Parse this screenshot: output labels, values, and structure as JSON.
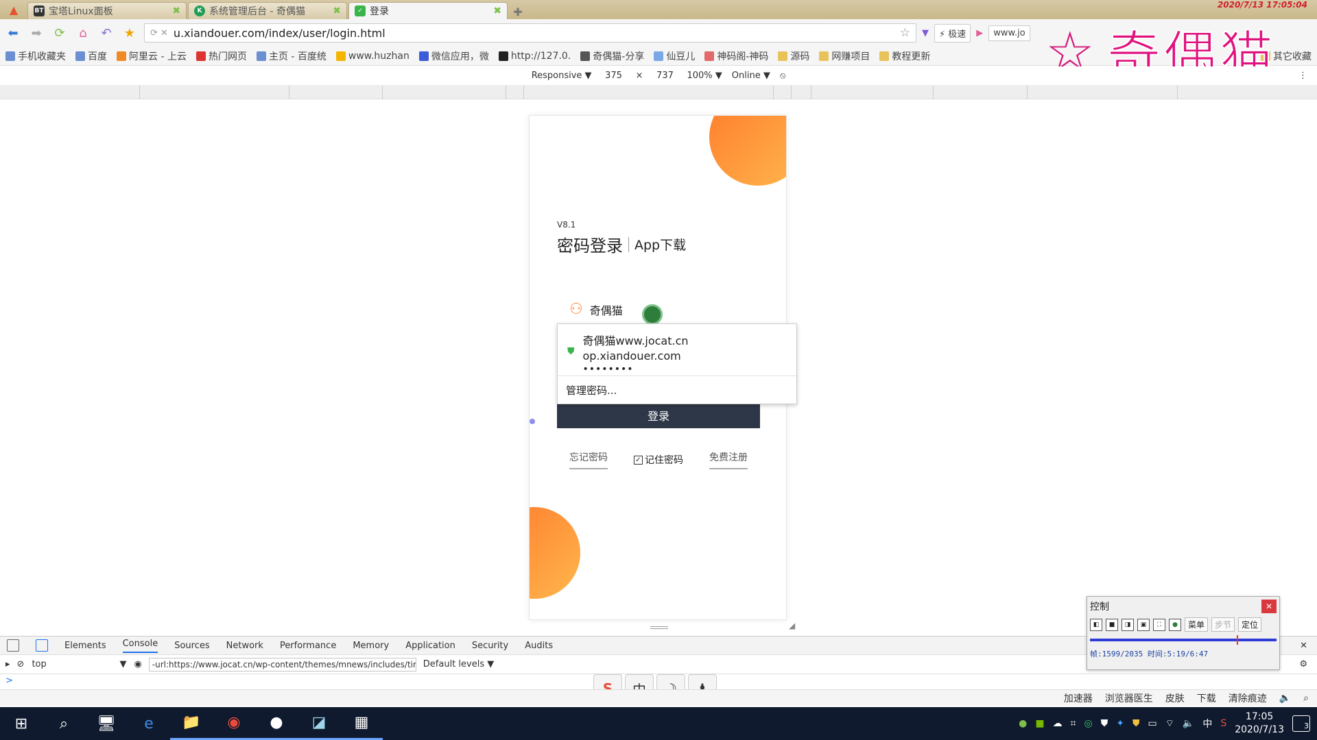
{
  "browser": {
    "tabs": [
      {
        "label": "宝塔Linux面板",
        "icon": "BT",
        "color": "#333333"
      },
      {
        "label": "系统管理后台 - 奇偶猫",
        "icon": "K",
        "color": "#1f9d55"
      },
      {
        "label": "登录",
        "icon": "shield",
        "color": "#3bb54a",
        "active": true
      }
    ],
    "datestamp": "2020/7/13  17:05:04",
    "url": "u.xiandouer.com/index/user/login.html",
    "speed_label": "极速",
    "sidebox_url": "www.jo",
    "bookmarks": [
      "手机收藏夹",
      "百度",
      "阿里云 - 上云",
      "热门网页",
      "主页 - 百度统",
      "www.huzhan",
      "微信应用，微",
      "http://127.0.",
      "奇偶猫-分享",
      "仙豆儿",
      "神码阁-神码",
      "源码",
      "网赚项目",
      "教程更新",
      "其它收藏"
    ]
  },
  "watermark": {
    "text": "奇偶猫"
  },
  "device_toolbar": {
    "mode": "Responsive ▼",
    "width": "375",
    "times": "×",
    "height": "737",
    "zoom": "100% ▼",
    "network": "Online ▼"
  },
  "page": {
    "version": "V8.1",
    "title_primary": "密码登录",
    "title_secondary": "App下载",
    "username_value": "奇偶猫",
    "login_button": "登录",
    "forgot_password": "忘记密码",
    "remember_password": "记住密码",
    "register": "免费注册"
  },
  "autofill": {
    "account": "奇偶猫www.jocat.cn  op.xiandouer.com",
    "password_mask": "••••••••",
    "manage": "管理密码..."
  },
  "devtools": {
    "tabs": [
      "Elements",
      "Console",
      "Sources",
      "Network",
      "Performance",
      "Memory",
      "Application",
      "Security",
      "Audits"
    ],
    "active_tab": "Console",
    "context": "top",
    "filter_value": "-url:https://www.jocat.cn/wp-content/themes/mnews/includes/tim",
    "levels": "Default levels ▼",
    "prompt": ">"
  },
  "statusbar": [
    "加速器",
    "浏览器医生",
    "皮肤",
    "下载",
    "清除痕迹"
  ],
  "control_window": {
    "title": "控制",
    "menu_btn": "菜单",
    "step_btn": "步节",
    "locate_btn": "定位",
    "frame_info": "帧:1599/2035  时间:5:19/6:47",
    "progress": 0.786
  },
  "taskbar": {
    "time": "17:05",
    "date": "2020/7/13",
    "ime": "中",
    "notifications": "3"
  }
}
